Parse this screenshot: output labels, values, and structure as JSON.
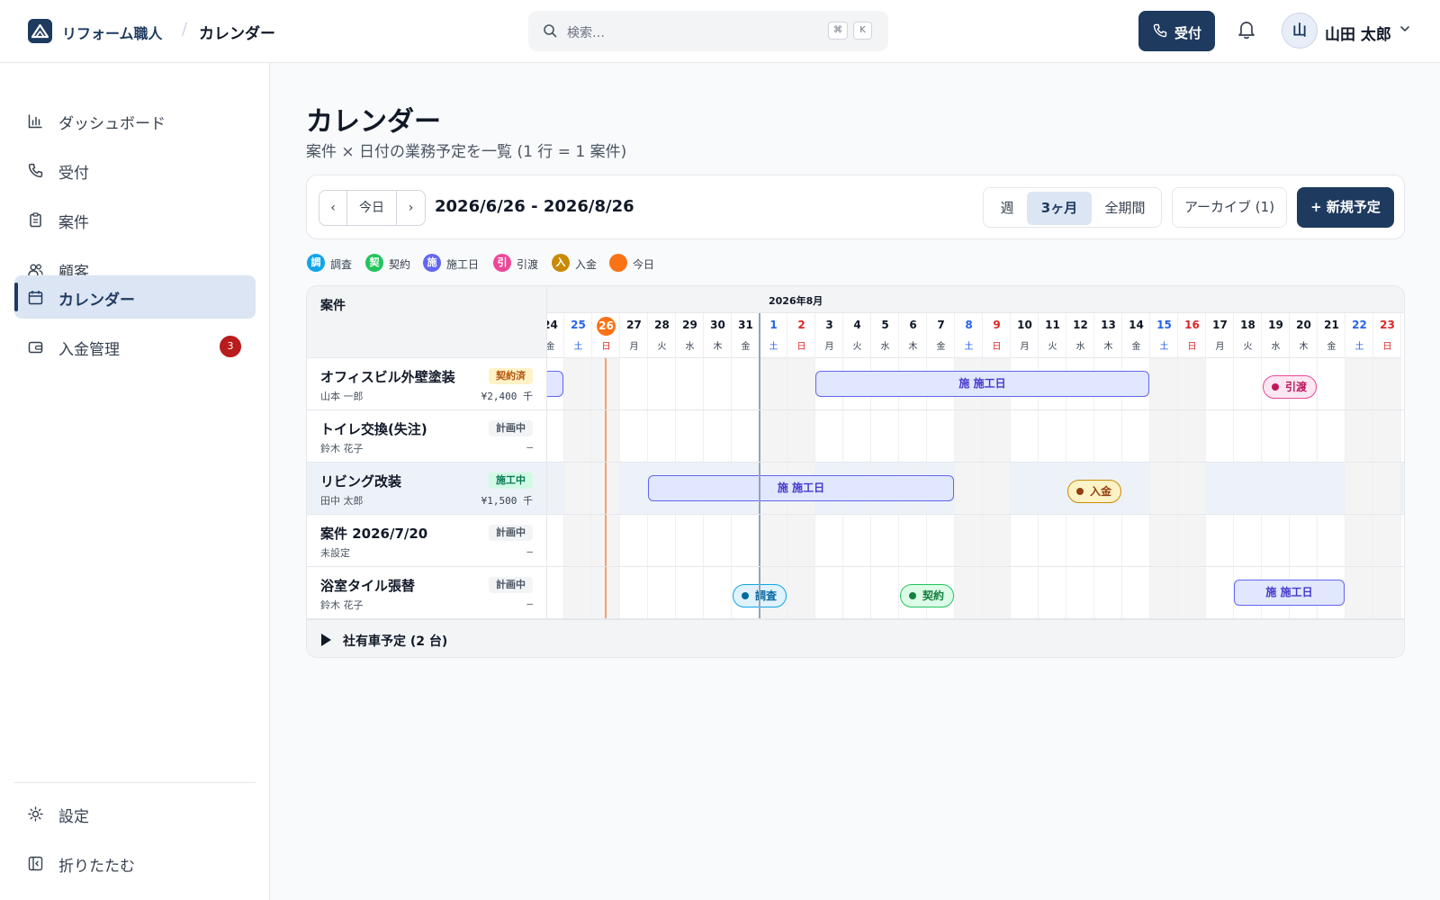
{
  "header": {
    "app_name": "リフォーム職人",
    "breadcrumb_sep": "/",
    "current_page": "カレンダー",
    "search_placeholder": "検索…",
    "kbd_cmd": "⌘",
    "kbd_k": "K",
    "receive_button": "受付",
    "user_initial": "山",
    "user_name": "山田 太郎"
  },
  "sidebar": {
    "items": [
      {
        "label": "ダッシュボード",
        "icon": "bar-chart-icon"
      },
      {
        "label": "受付",
        "icon": "phone-icon"
      },
      {
        "label": "案件",
        "icon": "clipboard-icon"
      },
      {
        "label": "顧客",
        "icon": "users-icon"
      },
      {
        "label": "カレンダー",
        "icon": "calendar-icon",
        "active": true
      },
      {
        "label": "入金管理",
        "icon": "wallet-icon",
        "badge": "3"
      }
    ],
    "settings": "設定",
    "collapse": "折りたたむ"
  },
  "page": {
    "title": "カレンダー",
    "subtitle": "案件 × 日付の業務予定を一覧 (1 行 = 1 案件)"
  },
  "toolbar": {
    "prev": "‹",
    "today": "今日",
    "next": "›",
    "range": "2026/6/26 - 2026/8/26",
    "views": [
      "週",
      "3ヶ月",
      "全期間"
    ],
    "selected_view": "3ヶ月",
    "archive": "アーカイブ (1)",
    "new_event": "+ 新規予定"
  },
  "legend": [
    {
      "glyph": "調",
      "label": "調査",
      "color": "#0ea5e9"
    },
    {
      "glyph": "契",
      "label": "契約",
      "color": "#22c55e"
    },
    {
      "glyph": "施",
      "label": "施工日",
      "color": "#6366f1"
    },
    {
      "glyph": "引",
      "label": "引渡",
      "color": "#ec4899"
    },
    {
      "glyph": "入",
      "label": "入金",
      "color": "#ca8a04"
    },
    {
      "glyph": "",
      "label": "今日",
      "color": "#f97316"
    }
  ],
  "grid": {
    "case_header": "案件",
    "month_label": "2026年8月",
    "days": [
      {
        "d": "24",
        "w": "金"
      },
      {
        "d": "25",
        "w": "土"
      },
      {
        "d": "26",
        "w": "日"
      },
      {
        "d": "27",
        "w": "月"
      },
      {
        "d": "28",
        "w": "火"
      },
      {
        "d": "29",
        "w": "水"
      },
      {
        "d": "30",
        "w": "木"
      },
      {
        "d": "31",
        "w": "金"
      },
      {
        "d": "1",
        "w": "土"
      },
      {
        "d": "2",
        "w": "日"
      },
      {
        "d": "3",
        "w": "月"
      },
      {
        "d": "4",
        "w": "火"
      },
      {
        "d": "5",
        "w": "水"
      },
      {
        "d": "6",
        "w": "木"
      },
      {
        "d": "7",
        "w": "金"
      },
      {
        "d": "8",
        "w": "土"
      },
      {
        "d": "9",
        "w": "日"
      },
      {
        "d": "10",
        "w": "月"
      },
      {
        "d": "11",
        "w": "火"
      },
      {
        "d": "12",
        "w": "水"
      },
      {
        "d": "13",
        "w": "木"
      },
      {
        "d": "14",
        "w": "金"
      },
      {
        "d": "15",
        "w": "土"
      },
      {
        "d": "16",
        "w": "日"
      },
      {
        "d": "17",
        "w": "月"
      },
      {
        "d": "18",
        "w": "火"
      },
      {
        "d": "19",
        "w": "水"
      },
      {
        "d": "20",
        "w": "木"
      },
      {
        "d": "21",
        "w": "金"
      },
      {
        "d": "22",
        "w": "土"
      },
      {
        "d": "23",
        "w": "日"
      }
    ],
    "today_day": "26",
    "cases": [
      {
        "name": "オフィスビル外壁塗装",
        "customer": "山本 一郎",
        "status": "契約済",
        "status_kind": "signed",
        "amount": "¥2,400 千",
        "events": [
          {
            "type": "bar",
            "label": "",
            "start": "24",
            "end": "24"
          },
          {
            "type": "bar",
            "label": "施 施工日",
            "start": "3",
            "end": "14"
          },
          {
            "type": "pill",
            "kind": "handover",
            "label": "引渡",
            "day": "19"
          }
        ]
      },
      {
        "name": "トイレ交換(失注)",
        "customer": "鈴木 花子",
        "status": "計画中",
        "status_kind": "plan",
        "amount": "–",
        "events": []
      },
      {
        "name": "リビング改装",
        "customer": "田中 太郎",
        "status": "施工中",
        "status_kind": "work",
        "amount": "¥1,500 千",
        "highlight": true,
        "events": [
          {
            "type": "bar",
            "label": "施 施工日",
            "start": "28",
            "end": "7"
          },
          {
            "type": "pill",
            "kind": "payment",
            "label": "入金",
            "day": "12"
          }
        ]
      },
      {
        "name": "案件 2026/7/20",
        "customer": "未設定",
        "status": "計画中",
        "status_kind": "plan",
        "amount": "–",
        "events": []
      },
      {
        "name": "浴室タイル張替",
        "customer": "鈴木 花子",
        "status": "計画中",
        "status_kind": "plan",
        "amount": "–",
        "events": [
          {
            "type": "pill",
            "kind": "survey",
            "label": "調査",
            "day": "31"
          },
          {
            "type": "pill",
            "kind": "contract",
            "label": "契約",
            "day": "6"
          },
          {
            "type": "bar",
            "label": "施 施工日",
            "start": "18",
            "end": "21"
          }
        ]
      }
    ],
    "footer_label": "社有車予定 (2 台)"
  }
}
